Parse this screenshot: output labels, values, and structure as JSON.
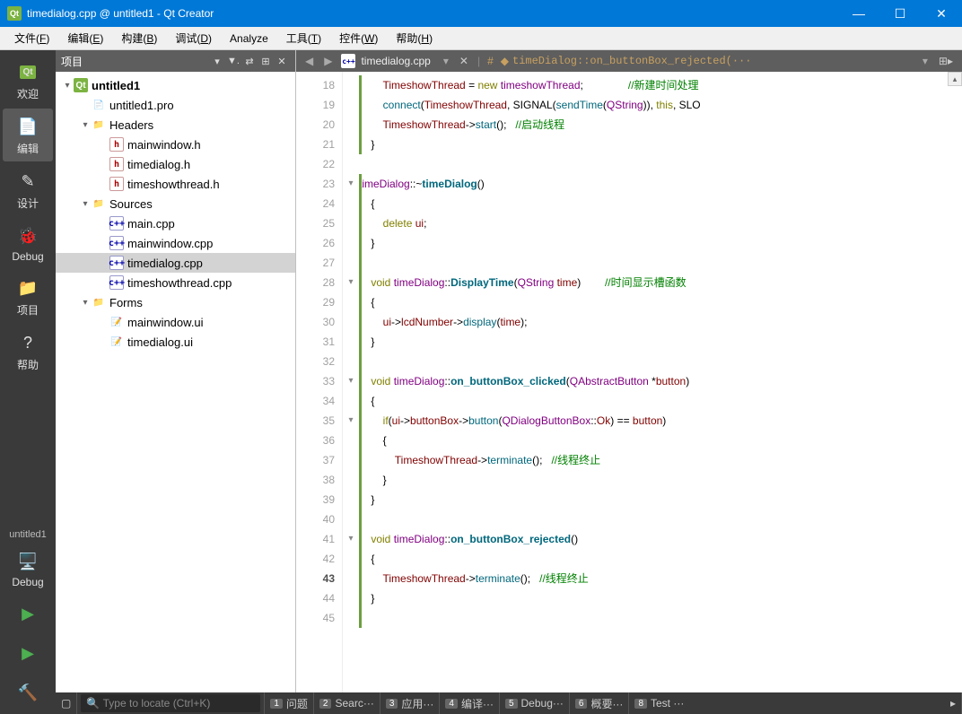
{
  "window": {
    "title": "timedialog.cpp @ untitled1 - Qt Creator"
  },
  "menu": [
    {
      "label": "文件",
      "key": "F"
    },
    {
      "label": "编辑",
      "key": "E"
    },
    {
      "label": "构建",
      "key": "B"
    },
    {
      "label": "调试",
      "key": "D"
    },
    {
      "label": "Analyze",
      "key": ""
    },
    {
      "label": "工具",
      "key": "T"
    },
    {
      "label": "控件",
      "key": "W"
    },
    {
      "label": "帮助",
      "key": "H"
    }
  ],
  "leftbar": [
    {
      "label": "欢迎",
      "icon": "Qt",
      "active": false
    },
    {
      "label": "编辑",
      "icon": "📄",
      "active": true
    },
    {
      "label": "设计",
      "icon": "✎",
      "active": false
    },
    {
      "label": "Debug",
      "icon": "🐞",
      "active": false
    },
    {
      "label": "项目",
      "icon": "📁",
      "active": false
    },
    {
      "label": "帮助",
      "icon": "?",
      "active": false
    }
  ],
  "leftbottom": {
    "project": "untitled1",
    "config": "Debug"
  },
  "projectHeader": {
    "title": "项目"
  },
  "tree": [
    {
      "indent": 0,
      "arrow": "▾",
      "icon": "qt",
      "label": "untitled1",
      "bold": true
    },
    {
      "indent": 1,
      "arrow": "",
      "icon": "pro",
      "label": "untitled1.pro"
    },
    {
      "indent": 1,
      "arrow": "▾",
      "icon": "folder",
      "label": "Headers"
    },
    {
      "indent": 2,
      "arrow": "",
      "icon": "h",
      "label": "mainwindow.h"
    },
    {
      "indent": 2,
      "arrow": "",
      "icon": "h",
      "label": "timedialog.h"
    },
    {
      "indent": 2,
      "arrow": "",
      "icon": "h",
      "label": "timeshowthread.h"
    },
    {
      "indent": 1,
      "arrow": "▾",
      "icon": "folder",
      "label": "Sources"
    },
    {
      "indent": 2,
      "arrow": "",
      "icon": "cpp",
      "label": "main.cpp"
    },
    {
      "indent": 2,
      "arrow": "",
      "icon": "cpp",
      "label": "mainwindow.cpp"
    },
    {
      "indent": 2,
      "arrow": "",
      "icon": "cpp",
      "label": "timedialog.cpp",
      "selected": true
    },
    {
      "indent": 2,
      "arrow": "",
      "icon": "cpp",
      "label": "timeshowthread.cpp"
    },
    {
      "indent": 1,
      "arrow": "▾",
      "icon": "folder",
      "label": "Forms"
    },
    {
      "indent": 2,
      "arrow": "",
      "icon": "ui",
      "label": "mainwindow.ui"
    },
    {
      "indent": 2,
      "arrow": "",
      "icon": "ui",
      "label": "timedialog.ui"
    }
  ],
  "editorTab": {
    "file": "timedialog.cpp",
    "crumb": "timeDialog::on_buttonBox_rejected(···"
  },
  "code": {
    "start": 18,
    "fold": {
      "23": "▾",
      "28": "▾",
      "33": "▾",
      "35": "▾",
      "41": "▾"
    },
    "lines": [
      "        <span class='ident'>TimeshowThread</span> <span class='op'>=</span> <span class='kw'>new</span> <span class='type'>timeshowThread</span>;               <span class='cmt'>//新建时间处理</span>",
      "        <span class='funcname'>connect</span>(<span class='ident'>TimeshowThread</span>, <span class='plain'>SIGNAL</span>(<span class='funcname'>sendTime</span>(<span class='type'>QString</span>)), <span class='kw'>this</span>, <span class='plain'>SLO</span>",
      "        <span class='ident'>TimeshowThread</span>-&gt;<span class='funcname'>start</span>();   <span class='cmt'>//启动线程</span>",
      "    }",
      "",
      "<span class='type'>timeDialog</span>::~<span class='func'>timeDialog</span>()",
      "    {",
      "        <span class='kw'>delete</span> <span class='ident'>ui</span>;",
      "    }",
      "",
      "    <span class='kw'>void</span> <span class='type'>timeDialog</span>::<span class='func'>DisplayTime</span>(<span class='type'>QString</span> <span class='ident'>time</span>)        <span class='cmt'>//时间显示槽函数</span>",
      "    {",
      "        <span class='ident'>ui</span>-&gt;<span class='ident'>lcdNumber</span>-&gt;<span class='funcname'>display</span>(<span class='ident'>time</span>);",
      "    }",
      "",
      "    <span class='kw'>void</span> <span class='type'>timeDialog</span>::<span class='func'>on_buttonBox_clicked</span>(<span class='type'>QAbstractButton</span> *<span class='ident'>button</span>)",
      "    {",
      "        <span class='kw'>if</span>(<span class='ident'>ui</span>-&gt;<span class='ident'>buttonBox</span>-&gt;<span class='funcname'>button</span>(<span class='type'>QDialogButtonBox</span>::<span class='ident'>Ok</span>) <span class='op'>==</span> <span class='ident'>button</span>)",
      "        {",
      "            <span class='ident'>TimeshowThread</span>-&gt;<span class='funcname'>terminate</span>();   <span class='cmt'>//线程终止</span>",
      "        }",
      "    }",
      "",
      "    <span class='kw'>void</span> <span class='type'>timeDialog</span>::<span class='func'>on_buttonBox_rejected</span>()",
      "    {",
      "        <span class='ident'>TimeshowThread</span>-&gt;<span class='funcname'>terminate</span>();   <span class='cmt'>//线程终止</span>",
      "    }",
      ""
    ]
  },
  "status": {
    "locate": "Type to locate (Ctrl+K)",
    "panes": [
      {
        "n": "1",
        "t": "问题"
      },
      {
        "n": "2",
        "t": "Searc···"
      },
      {
        "n": "3",
        "t": "应用···"
      },
      {
        "n": "4",
        "t": "编译···"
      },
      {
        "n": "5",
        "t": "Debug···"
      },
      {
        "n": "6",
        "t": "概要···"
      },
      {
        "n": "8",
        "t": "Test ···"
      }
    ]
  }
}
